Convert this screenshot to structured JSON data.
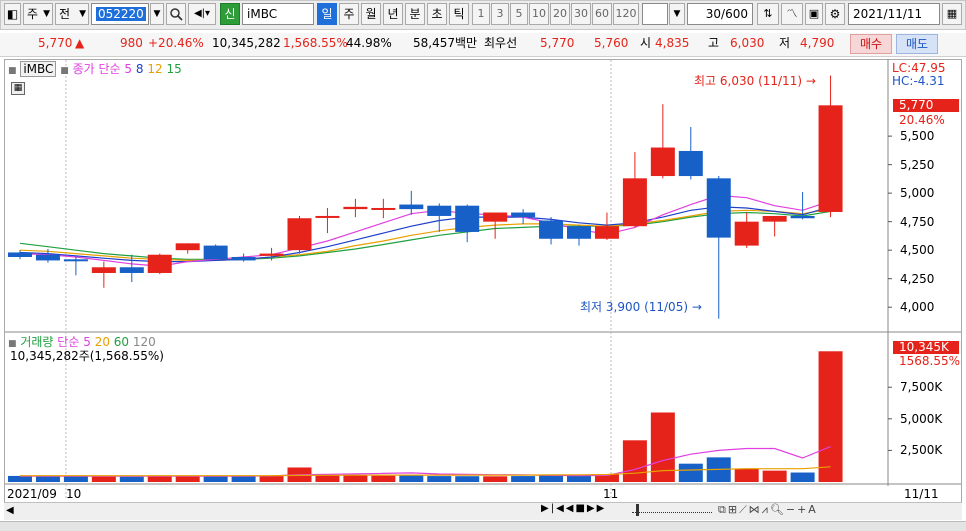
{
  "toolbar": {
    "market": "주",
    "scope": "전",
    "code": "052220",
    "shin": "신",
    "stock_name": "iMBC",
    "periods": [
      "일",
      "주",
      "월",
      "년",
      "분",
      "초",
      "틱"
    ],
    "active_period": "일",
    "minute_options": [
      "1",
      "3",
      "5",
      "10",
      "20",
      "30",
      "60",
      "120"
    ],
    "count_value": "30/600",
    "date_value": "2021/11/11"
  },
  "quote": {
    "price": "5,770",
    "arrow": "▲",
    "change": "980",
    "change_pct": "+20.46%",
    "volume": "10,345,282",
    "volume_pct": "1,568.55%",
    "turnover": "44.98%",
    "amount": "58,457백만",
    "best_label": "최우선",
    "ask": "5,770",
    "bid": "5,760",
    "open_label": "시",
    "open": "4,835",
    "high_label": "고",
    "high": "6,030",
    "low_label": "저",
    "low": "4,790",
    "buy_button": "매수",
    "sell_button": "매도"
  },
  "price_panel": {
    "legend_name": "iMBC",
    "legend_ma": "종가 단순",
    "ma_periods": [
      "5",
      "8",
      "12",
      "15"
    ],
    "ma_colors": [
      "#e040e0",
      "#1d3fcc",
      "#e8a000",
      "#20a040"
    ],
    "lc_label": "LC:47.95",
    "hc_label": "HC:-4.31",
    "current_price": "5,770",
    "current_pct": "20.46%",
    "y_ticks": [
      "5,500",
      "5,250",
      "5,000",
      "4,750",
      "4,500",
      "4,250",
      "4,000"
    ],
    "high_annotation": "최고 6,030 (11/11)",
    "low_annotation": "최저 3,900 (11/05)"
  },
  "volume_panel": {
    "legend_name": "거래량",
    "legend_ma": "단순",
    "ma_periods": [
      "5",
      "20",
      "60",
      "120"
    ],
    "ma_colors": [
      "#e040e0",
      "#e8a000",
      "#20a040",
      "#888888"
    ],
    "info": "10,345,282주(1,568.55%)",
    "current_volume": "10,345K",
    "current_pct": "1568.55%",
    "y_ticks": [
      "7,500K",
      "5,000K",
      "2,500K"
    ]
  },
  "x_axis": {
    "labels": [
      "2021/09",
      "10",
      "11"
    ],
    "end_label": "11/11"
  },
  "colors": {
    "up": "#e5231a",
    "down": "#1660c8",
    "accent": "#1e6fd9"
  },
  "chart_data": {
    "type": "candlestick",
    "y_range": [
      3800,
      6150
    ],
    "candles": [
      {
        "o": 4480,
        "h": 4500,
        "l": 4420,
        "c": 4440
      },
      {
        "o": 4460,
        "h": 4510,
        "l": 4390,
        "c": 4410
      },
      {
        "o": 4420,
        "h": 4440,
        "l": 4280,
        "c": 4410
      },
      {
        "o": 4300,
        "h": 4400,
        "l": 4170,
        "c": 4350
      },
      {
        "o": 4350,
        "h": 4460,
        "l": 4220,
        "c": 4300
      },
      {
        "o": 4300,
        "h": 4470,
        "l": 4290,
        "c": 4460
      },
      {
        "o": 4500,
        "h": 4560,
        "l": 4470,
        "c": 4560
      },
      {
        "o": 4540,
        "h": 4550,
        "l": 4420,
        "c": 4420
      },
      {
        "o": 4440,
        "h": 4470,
        "l": 4400,
        "c": 4410
      },
      {
        "o": 4450,
        "h": 4520,
        "l": 4410,
        "c": 4470
      },
      {
        "o": 4500,
        "h": 4800,
        "l": 4470,
        "c": 4780
      },
      {
        "o": 4790,
        "h": 4870,
        "l": 4650,
        "c": 4800
      },
      {
        "o": 4860,
        "h": 4950,
        "l": 4790,
        "c": 4880
      },
      {
        "o": 4860,
        "h": 4950,
        "l": 4780,
        "c": 4870
      },
      {
        "o": 4900,
        "h": 5020,
        "l": 4810,
        "c": 4860
      },
      {
        "o": 4890,
        "h": 4910,
        "l": 4660,
        "c": 4800
      },
      {
        "o": 4890,
        "h": 4900,
        "l": 4570,
        "c": 4660
      },
      {
        "o": 4750,
        "h": 4830,
        "l": 4600,
        "c": 4830
      },
      {
        "o": 4830,
        "h": 4860,
        "l": 4730,
        "c": 4790
      },
      {
        "o": 4760,
        "h": 4790,
        "l": 4550,
        "c": 4600
      },
      {
        "o": 4710,
        "h": 4720,
        "l": 4540,
        "c": 4600
      },
      {
        "o": 4600,
        "h": 4830,
        "l": 4590,
        "c": 4710
      },
      {
        "o": 4710,
        "h": 5360,
        "l": 4700,
        "c": 5130
      },
      {
        "o": 5150,
        "h": 5780,
        "l": 5130,
        "c": 5400
      },
      {
        "o": 5370,
        "h": 5580,
        "l": 5120,
        "c": 5150
      },
      {
        "o": 5130,
        "h": 5150,
        "l": 3900,
        "c": 4610
      },
      {
        "o": 4540,
        "h": 4830,
        "l": 4520,
        "c": 4750
      },
      {
        "o": 4750,
        "h": 4790,
        "l": 4620,
        "c": 4800
      },
      {
        "o": 4800,
        "h": 5010,
        "l": 4770,
        "c": 4780
      },
      {
        "o": 4835,
        "h": 6030,
        "l": 4790,
        "c": 5770
      }
    ],
    "ma5": [
      4470,
      4460,
      4440,
      4410,
      4380,
      4360,
      4400,
      4420,
      4440,
      4460,
      4520,
      4580,
      4660,
      4740,
      4820,
      4850,
      4820,
      4810,
      4790,
      4740,
      4680,
      4640,
      4700,
      4810,
      4900,
      4980,
      4960,
      4890,
      4850,
      4930
    ],
    "ma8": [
      4480,
      4470,
      4450,
      4430,
      4410,
      4400,
      4400,
      4410,
      4420,
      4440,
      4480,
      4530,
      4590,
      4650,
      4710,
      4760,
      4790,
      4790,
      4790,
      4770,
      4740,
      4720,
      4740,
      4790,
      4850,
      4880,
      4870,
      4840,
      4810,
      4880
    ],
    "ma12": [
      4500,
      4490,
      4470,
      4450,
      4430,
      4420,
      4410,
      4410,
      4420,
      4440,
      4460,
      4490,
      4540,
      4580,
      4630,
      4670,
      4700,
      4720,
      4730,
      4730,
      4720,
      4710,
      4730,
      4760,
      4800,
      4840,
      4850,
      4840,
      4820,
      4860
    ],
    "ma15": [
      4560,
      4530,
      4500,
      4470,
      4450,
      4430,
      4420,
      4420,
      4420,
      4430,
      4450,
      4480,
      4510,
      4550,
      4590,
      4630,
      4660,
      4690,
      4700,
      4710,
      4710,
      4710,
      4720,
      4750,
      4790,
      4820,
      4830,
      4820,
      4800,
      4840
    ],
    "volume": [
      480,
      500,
      470,
      430,
      420,
      460,
      520,
      500,
      480,
      470,
      1150,
      540,
      560,
      500,
      520,
      470,
      460,
      450,
      470,
      520,
      500,
      600,
      3300,
      5500,
      1450,
      1950,
      1050,
      900,
      750,
      10345
    ],
    "vol_ma5": [
      470,
      470,
      470,
      460,
      460,
      460,
      460,
      470,
      470,
      480,
      580,
      600,
      640,
      680,
      720,
      630,
      600,
      580,
      570,
      520,
      500,
      520,
      1000,
      1700,
      2200,
      2500,
      2650,
      2650,
      1900,
      2800
    ],
    "vol_ma20": [
      500,
      500,
      500,
      500,
      500,
      500,
      500,
      500,
      500,
      500,
      520,
      530,
      540,
      550,
      550,
      550,
      550,
      550,
      550,
      560,
      570,
      590,
      700,
      900,
      950,
      1000,
      1050,
      1050,
      1050,
      1200
    ],
    "volume_range": [
      0,
      11000
    ]
  }
}
